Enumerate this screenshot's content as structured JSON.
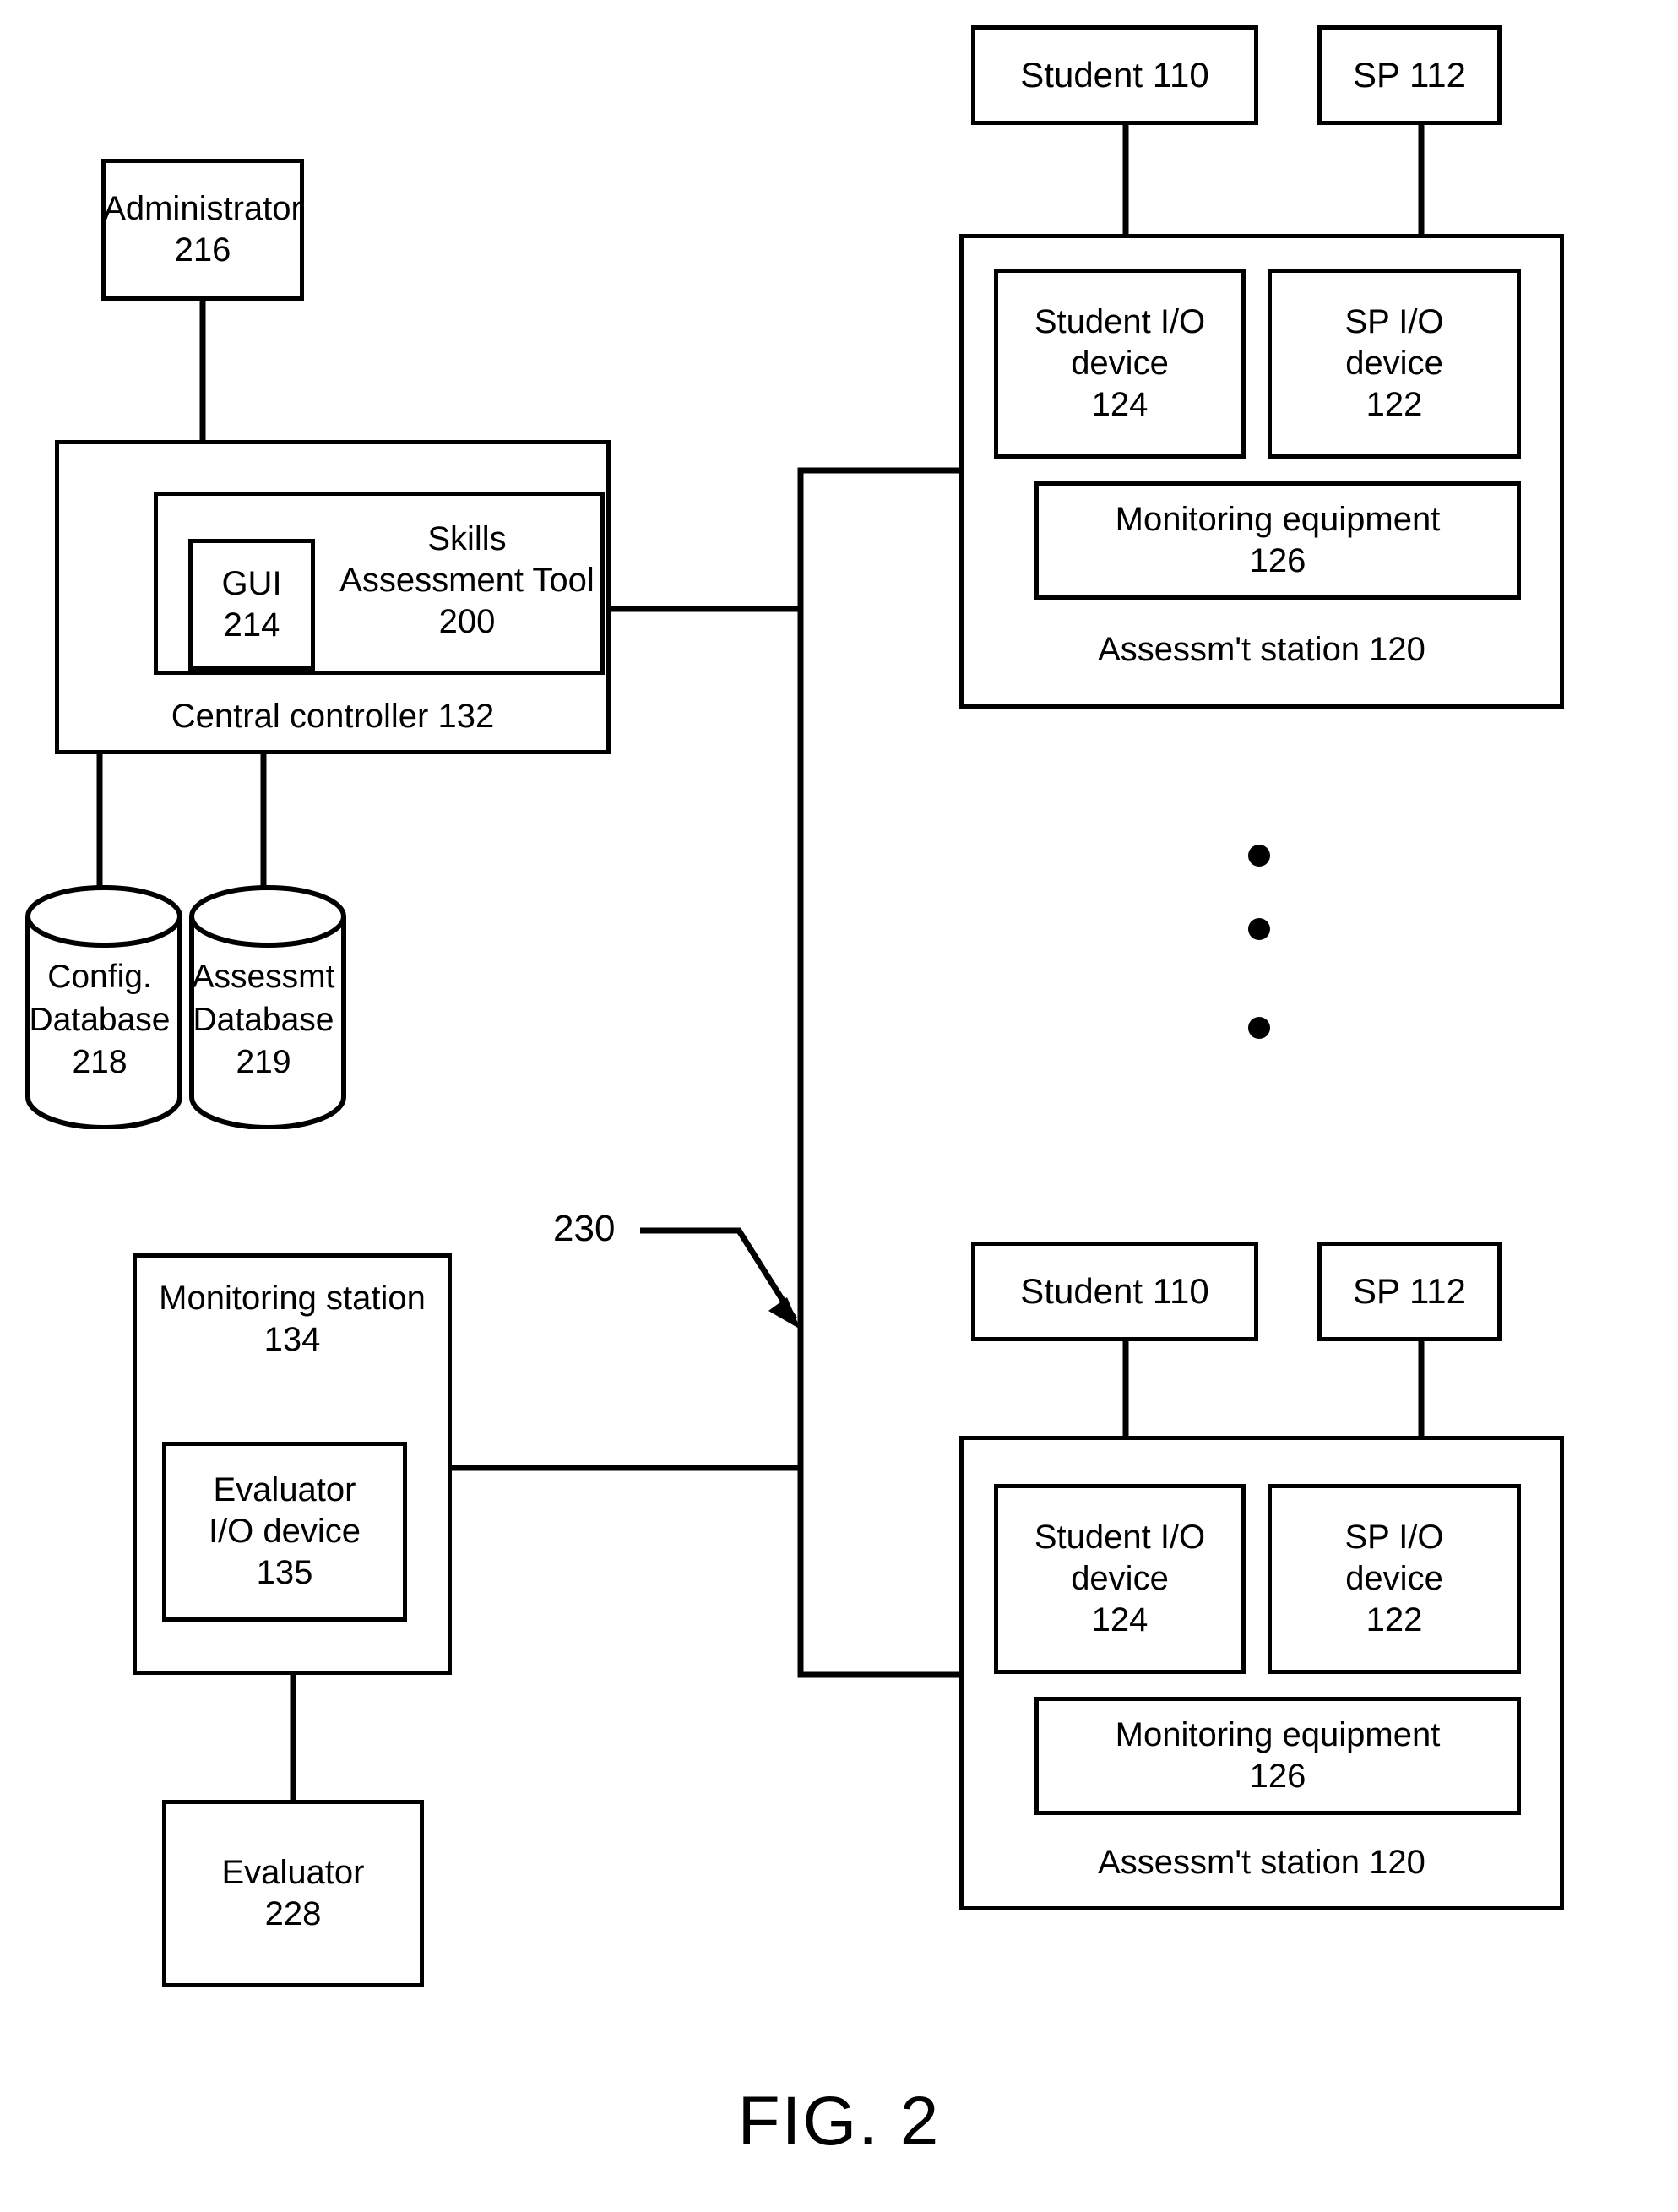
{
  "figure": {
    "caption": "FIG. 2",
    "reference_callout": "230"
  },
  "left_column": {
    "administrator": {
      "line1": "Administrator",
      "line2": "216"
    },
    "central_controller": {
      "label": "Central controller 132",
      "skills_tool": {
        "line1": "Skills",
        "line2": "Assessment",
        "line3": "Tool 200"
      },
      "gui": {
        "line1": "GUI",
        "line2": "214"
      }
    },
    "config_database": {
      "line1": "Config.",
      "line2": "Database",
      "line3": "218"
    },
    "assessment_database": {
      "line1": "Assessmt",
      "line2": "Database",
      "line3": "219"
    },
    "monitoring_station": {
      "line1": "Monitoring",
      "line2": "station",
      "line3": "134",
      "evaluator_io": {
        "line1": "Evaluator",
        "line2": "I/O device",
        "line3": "135"
      }
    },
    "evaluator": {
      "line1": "Evaluator",
      "line2": "228"
    }
  },
  "stations": [
    {
      "student": "Student 110",
      "sp": "SP 112",
      "student_io": {
        "line1": "Student I/O",
        "line2": "device",
        "line3": "124"
      },
      "sp_io": {
        "line1": "SP I/O",
        "line2": "device",
        "line3": "122"
      },
      "monitoring_equipment": {
        "line1": "Monitoring equipment",
        "line2": "126"
      },
      "station_label": "Assessm't station 120"
    },
    {
      "student": "Student 110",
      "sp": "SP 112",
      "student_io": {
        "line1": "Student I/O",
        "line2": "device",
        "line3": "124"
      },
      "sp_io": {
        "line1": "SP I/O",
        "line2": "device",
        "line3": "122"
      },
      "monitoring_equipment": {
        "line1": "Monitoring equipment",
        "line2": "126"
      },
      "station_label": "Assessm't station 120"
    }
  ],
  "ellipsis": {
    "count": 3,
    "meaning": "additional assessment stations"
  },
  "colors": {
    "ink": "#000000",
    "paper": "#ffffff"
  }
}
